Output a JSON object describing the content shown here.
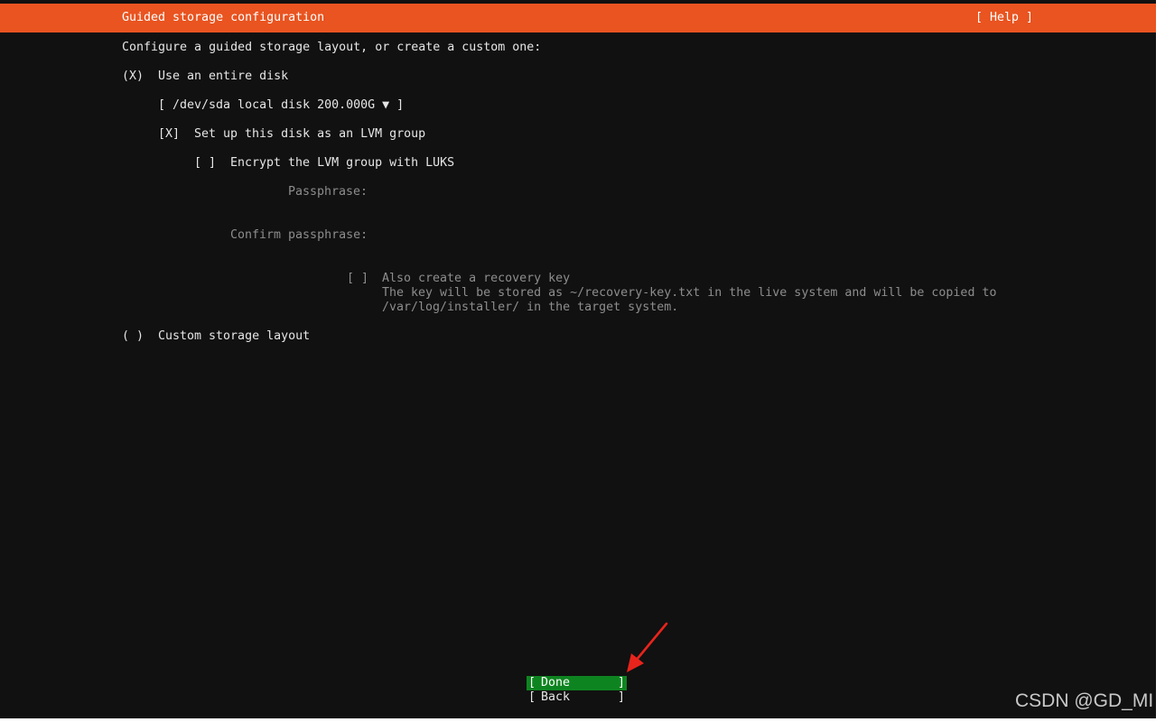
{
  "header": {
    "title": "Guided storage configuration",
    "help": "[ Help ]",
    "accent_color": "#e95420"
  },
  "intro": "Configure a guided storage layout, or create a custom one:",
  "entire_disk": {
    "radio": "(X)",
    "label": "Use an entire disk",
    "disk_select": "[ /dev/sda local disk 200.000G ▼ ]"
  },
  "lvm": {
    "checkbox": "[X]",
    "label": "Set up this disk as an LVM group"
  },
  "luks": {
    "checkbox": "[ ]",
    "label": "Encrypt the LVM group with LUKS"
  },
  "passphrase": {
    "label": "Passphrase:",
    "value": ""
  },
  "confirm_passphrase": {
    "label": "Confirm passphrase:",
    "value": ""
  },
  "recovery": {
    "checkbox": "[ ]",
    "label": "Also create a recovery key",
    "desc_line1": "The key will be stored as ~/recovery-key.txt in the live system and will be copied to",
    "desc_line2": "/var/log/installer/ in the target system."
  },
  "custom": {
    "radio": "( )",
    "label": "Custom storage layout"
  },
  "buttons": {
    "done": {
      "open": "[",
      "label": "Done",
      "close": "]",
      "color": "#0e8420"
    },
    "back": {
      "open": "[",
      "label": "Back",
      "close": "]"
    }
  },
  "annotation": {
    "arrow_color": "#e8241c"
  },
  "watermark": "CSDN @GD_MI"
}
